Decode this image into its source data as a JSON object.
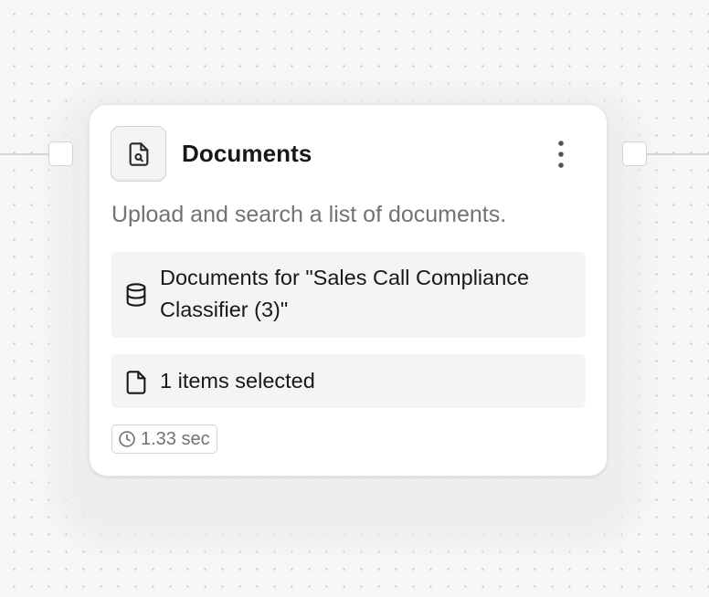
{
  "node": {
    "icon": "file-search-icon",
    "title": "Documents",
    "menu_icon": "more-vertical-icon",
    "description": "Upload and search a list of documents.",
    "dataset": {
      "icon": "database-icon",
      "label": "Documents for \"Sales Call Compliance Classifier (3)\""
    },
    "selection": {
      "icon": "file-icon",
      "label": "1 items selected"
    },
    "timing": {
      "icon": "clock-icon",
      "label": "1.33 sec"
    }
  }
}
